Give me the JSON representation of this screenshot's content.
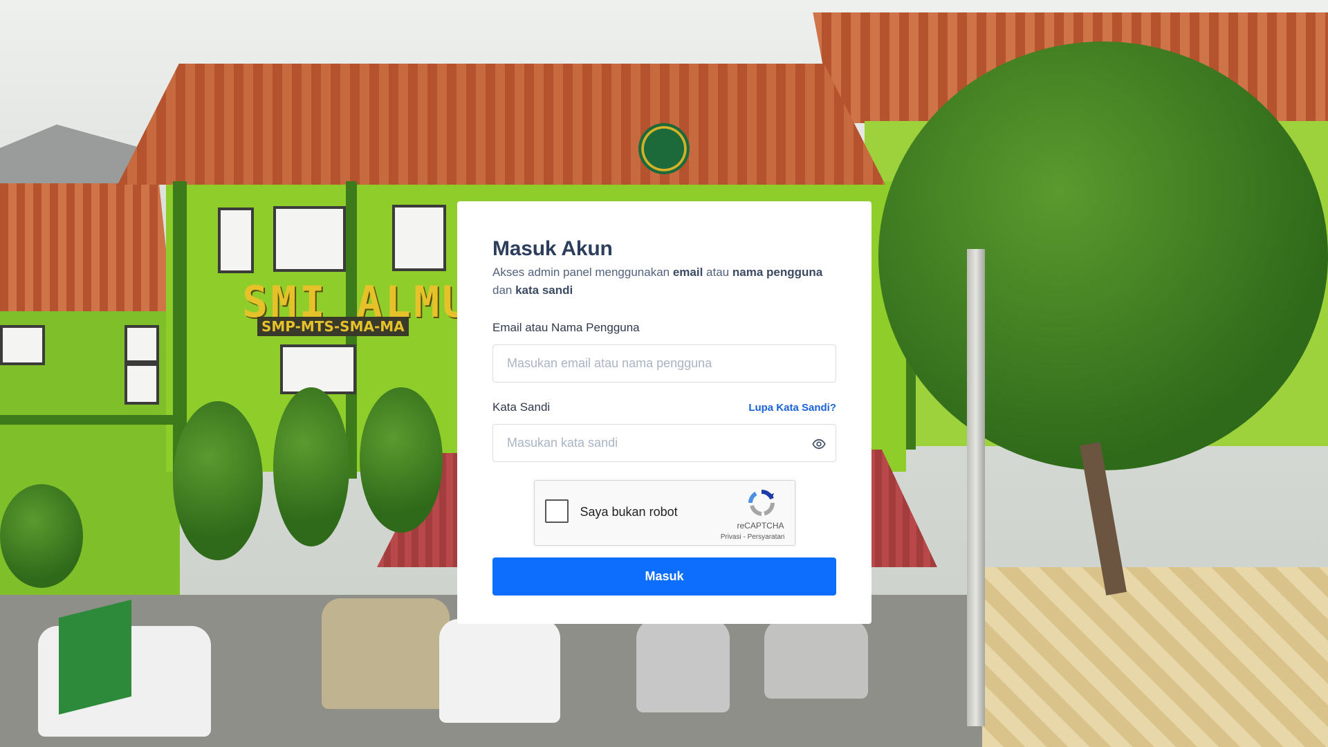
{
  "login": {
    "title": "Masuk Akun",
    "subtitle_prefix": "Akses admin panel menggunakan ",
    "subtitle_email": "email",
    "subtitle_or": " atau ",
    "subtitle_username": "nama pengguna",
    "subtitle_and": " dan ",
    "subtitle_password": "kata sandi",
    "email_label": "Email atau Nama Pengguna",
    "email_placeholder": "Masukan email atau nama pengguna",
    "email_value": "",
    "password_label": "Kata Sandi",
    "forgot_link": "Lupa Kata Sandi?",
    "password_placeholder": "Masukan kata sandi",
    "password_value": "",
    "password_toggle_icon": "eye-icon",
    "submit_label": "Masuk"
  },
  "captcha": {
    "checkbox_label": "Saya bukan robot",
    "brand": "reCAPTCHA",
    "links": "Privasi - Persyaratan",
    "checked": false,
    "icon": "recaptcha-icon"
  },
  "background": {
    "sign_text": "SMI ALMU",
    "sign_subtext": "SMP-MTS-SMA-MA",
    "emblem_icon": "school-emblem"
  },
  "colors": {
    "primary": "#0d6efd",
    "title": "#2c3e5c",
    "link": "#1a63d6"
  }
}
